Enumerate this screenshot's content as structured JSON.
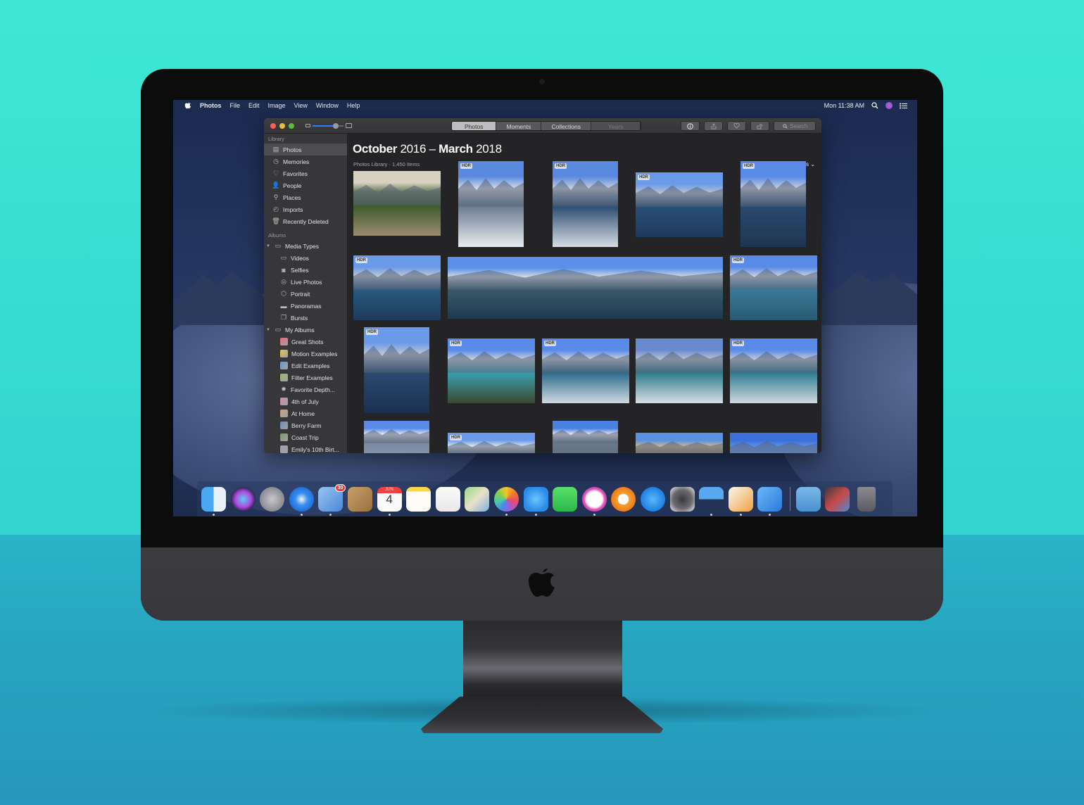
{
  "menubar": {
    "app_name": "Photos",
    "menus": [
      "File",
      "Edit",
      "Image",
      "View",
      "Window",
      "Help"
    ],
    "clock": "Mon 11:38 AM"
  },
  "window": {
    "view_tabs": [
      {
        "label": "Photos",
        "active": true
      },
      {
        "label": "Moments",
        "active": false
      },
      {
        "label": "Collections",
        "active": false
      },
      {
        "label": "Years",
        "active": false,
        "disabled": true
      }
    ],
    "toolbar": {
      "info_icon": "i",
      "search_placeholder": "Search"
    },
    "zoom_slider_level": 0.75
  },
  "sidebar": {
    "library_header": "Library",
    "library_items": [
      {
        "label": "Photos",
        "icon": "photos-icon",
        "selected": true
      },
      {
        "label": "Memories",
        "icon": "memories-icon"
      },
      {
        "label": "Favorites",
        "icon": "heart-icon"
      },
      {
        "label": "People",
        "icon": "person-icon"
      },
      {
        "label": "Places",
        "icon": "pin-icon"
      },
      {
        "label": "Imports",
        "icon": "clock-icon"
      },
      {
        "label": "Recently Deleted",
        "icon": "trash-icon"
      }
    ],
    "albums_header": "Albums",
    "media_types_label": "Media Types",
    "media_types": [
      {
        "label": "Videos",
        "icon": "video-icon"
      },
      {
        "label": "Selfies",
        "icon": "camera-icon"
      },
      {
        "label": "Live Photos",
        "icon": "live-photo-icon"
      },
      {
        "label": "Portrait",
        "icon": "cube-icon"
      },
      {
        "label": "Panoramas",
        "icon": "panorama-icon"
      },
      {
        "label": "Bursts",
        "icon": "burst-icon"
      }
    ],
    "my_albums_label": "My Albums",
    "my_albums": [
      {
        "label": "Great Shots",
        "color": "#e86a7c"
      },
      {
        "label": "Motion Examples",
        "color": "#e8c24a"
      },
      {
        "label": "Edit Examples",
        "color": "#6a9ad0"
      },
      {
        "label": "Filter Examples",
        "color": "#9ab86a"
      },
      {
        "label": "Favorite Depth...",
        "color": "gear"
      },
      {
        "label": "4th of July",
        "color": "#d08aa8"
      },
      {
        "label": "At Home",
        "color": "#c8a27a"
      },
      {
        "label": "Berry Farm",
        "color": "#6a8ac0"
      },
      {
        "label": "Coast Trip",
        "color": "#7a9a6a"
      },
      {
        "label": "Emily's 10th Birt...",
        "color": "#a0a0b0"
      }
    ]
  },
  "content": {
    "title_month_1": "October",
    "title_year_1": " 2016 – ",
    "title_month_2": "March",
    "title_year_2": " 2018",
    "subtitle": "Photos Library · 1,450 Items",
    "showing_label": "Showing: All Photos",
    "hdr_badge": "HDR",
    "photos": [
      {
        "scene": "bighorn-sheep-valley",
        "hdr": false
      },
      {
        "scene": "lake-snowy-logs",
        "hdr": true
      },
      {
        "scene": "lake-reflection-snow",
        "hdr": true
      },
      {
        "scene": "lake-reflection-wide",
        "hdr": true
      },
      {
        "scene": "lake-reflection-portrait",
        "hdr": true
      },
      {
        "scene": "lake-reflection",
        "hdr": true
      },
      {
        "scene": "lake-panorama",
        "hdr": false
      },
      {
        "scene": "lake-peaks",
        "hdr": true
      },
      {
        "scene": "lake-portrait-trees",
        "hdr": true
      },
      {
        "scene": "hammock-over-lake",
        "hdr": true
      },
      {
        "scene": "person-red-jacket-lake",
        "hdr": true
      },
      {
        "scene": "person-on-rock-lake",
        "hdr": false
      },
      {
        "scene": "person-on-rock-lake-2",
        "hdr": true
      },
      {
        "scene": "peaks-clouds",
        "hdr": false
      },
      {
        "scene": "clouds-rock",
        "hdr": true
      },
      {
        "scene": "cliff-clouds",
        "hdr": false
      },
      {
        "scene": "rocky-peaks",
        "hdr": false
      },
      {
        "scene": "blue-sky",
        "hdr": false
      }
    ]
  },
  "dock": {
    "apps": [
      {
        "name": "Finder",
        "running": true
      },
      {
        "name": "Siri",
        "running": false
      },
      {
        "name": "Launchpad",
        "running": false
      },
      {
        "name": "Safari",
        "running": true
      },
      {
        "name": "Mail",
        "running": true,
        "badge": "30"
      },
      {
        "name": "Contacts",
        "running": false
      },
      {
        "name": "Calendar",
        "running": true,
        "month": "JUN",
        "day": "4"
      },
      {
        "name": "Notes",
        "running": false
      },
      {
        "name": "Reminders",
        "running": false
      },
      {
        "name": "Maps",
        "running": false
      },
      {
        "name": "Photos",
        "running": true
      },
      {
        "name": "Messages",
        "running": true
      },
      {
        "name": "FaceTime",
        "running": false
      },
      {
        "name": "iTunes",
        "running": true
      },
      {
        "name": "iBooks",
        "running": false
      },
      {
        "name": "App Store",
        "running": false
      },
      {
        "name": "System Preferences",
        "running": false
      },
      {
        "name": "Keynote",
        "running": true
      },
      {
        "name": "Pages",
        "running": true
      },
      {
        "name": "Xcode",
        "running": true
      }
    ],
    "others": [
      {
        "name": "Downloads"
      },
      {
        "name": "Screenshot"
      },
      {
        "name": "Trash"
      }
    ]
  }
}
